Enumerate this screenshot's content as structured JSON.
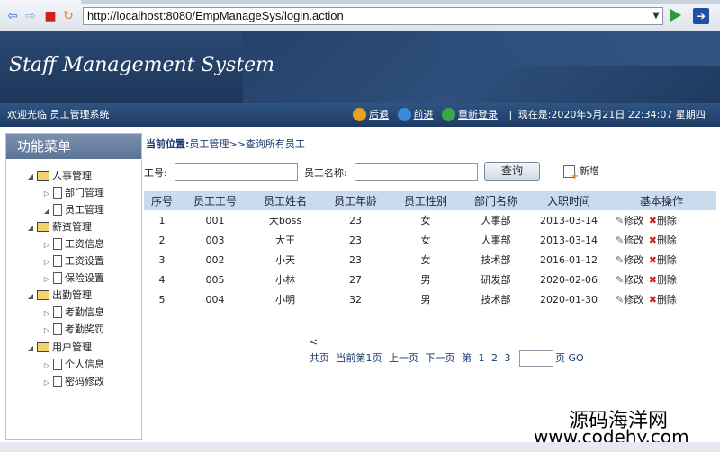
{
  "browser": {
    "url": "http://localhost:8080/EmpManageSys/login.action",
    "colors": {
      "go": "#2c9a3c"
    }
  },
  "header": {
    "title": "Staff Management System",
    "welcome": "欢迎光临 员工管理系统",
    "nav": {
      "back": "后退",
      "forward": "前进",
      "relogin": "重新登录",
      "time": "现在是:2020年5月21日 22:34:07 星期四"
    }
  },
  "sidebar": {
    "title": "功能菜单",
    "groups": [
      {
        "label": "人事管理",
        "items": [
          "部门管理",
          "员工管理"
        ]
      },
      {
        "label": "薪资管理",
        "items": [
          "工资信息",
          "工资设置",
          "保险设置"
        ]
      },
      {
        "label": "出勤管理",
        "items": [
          "考勤信息",
          "考勤奖罚"
        ]
      },
      {
        "label": "用户管理",
        "items": [
          "个人信息",
          "密码修改"
        ]
      }
    ]
  },
  "main": {
    "breadcrumb_label": "当前位置:",
    "breadcrumb_path": "员工管理>>查询所有员工",
    "search": {
      "id_label": "工号:",
      "name_label": "员工名称:",
      "button": "查询",
      "add": "新增"
    },
    "table": {
      "headers": [
        "序号",
        "员工工号",
        "员工姓名",
        "员工年龄",
        "员工性别",
        "部门名称",
        "入职时间",
        "基本操作"
      ],
      "rows": [
        [
          "1",
          "001",
          "大boss",
          "23",
          "女",
          "人事部",
          "2013-03-14"
        ],
        [
          "2",
          "003",
          "大王",
          "23",
          "女",
          "人事部",
          "2013-03-14"
        ],
        [
          "3",
          "002",
          "小天",
          "23",
          "女",
          "技术部",
          "2016-01-12"
        ],
        [
          "4",
          "005",
          "小林",
          "27",
          "男",
          "研发部",
          "2020-02-06"
        ],
        [
          "5",
          "004",
          "小明",
          "32",
          "男",
          "技术部",
          "2020-01-30"
        ]
      ],
      "edit": "修改",
      "delete": "删除"
    },
    "pager": {
      "prev_symbol": "<",
      "total": "共页",
      "current": "当前第1页",
      "prev": "上一页",
      "next": "下一页",
      "page_word": "第",
      "pages": [
        "1",
        "2",
        "3"
      ],
      "page_suffix": "页",
      "go": "GO"
    }
  },
  "watermark": {
    "line1": "源码海洋网",
    "line2": "www.codehy.com"
  }
}
